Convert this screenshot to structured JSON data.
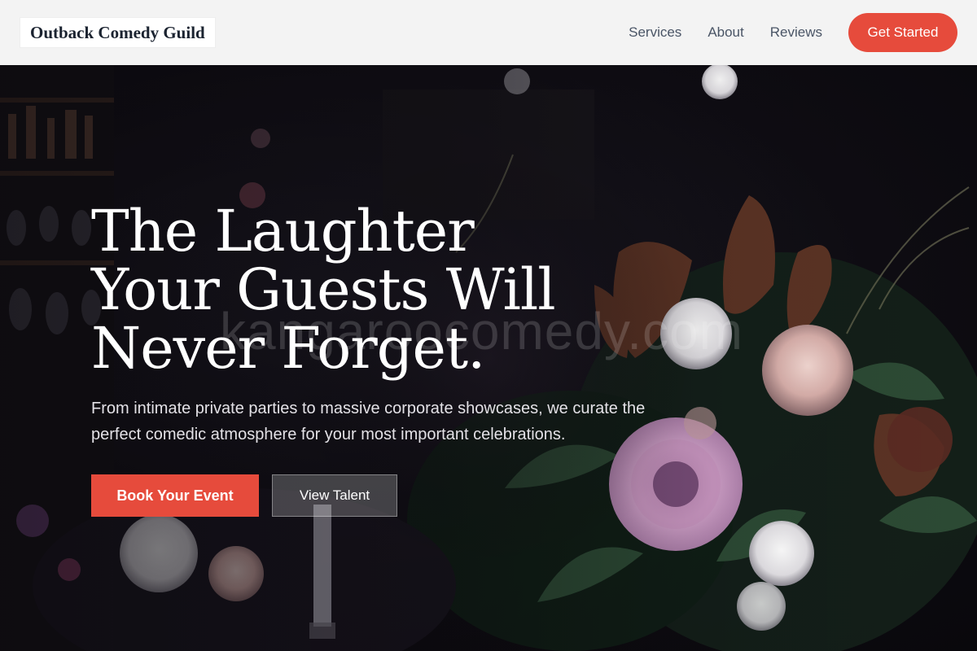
{
  "header": {
    "brand": "Outback Comedy Guild",
    "nav": [
      "Services",
      "About",
      "Reviews"
    ],
    "cta_label": "Get Started"
  },
  "hero": {
    "headline": "The Laughter Your Guests Will Never Forget.",
    "subhead": "From intimate private parties to massive corporate showcases, we curate the perfect comedic atmosphere for your most important celebrations.",
    "primary_label": "Book Your Event",
    "secondary_label": "View Talent",
    "watermark": "kangaroocomedy.com"
  },
  "colors": {
    "accent": "#e64b3c",
    "header_bg": "#f3f3f3",
    "brand_text": "#1b2330",
    "nav_text": "#4a5566",
    "hero_bg": "#0f0d12"
  }
}
